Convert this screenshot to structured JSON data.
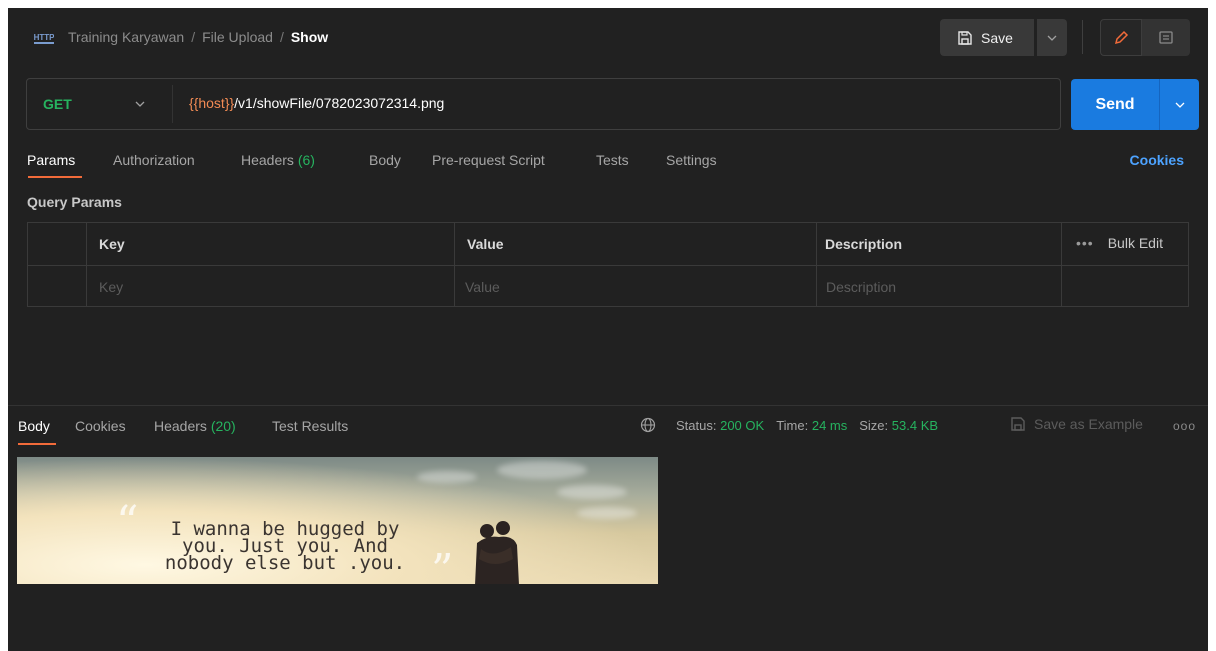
{
  "header": {
    "breadcrumb": [
      "Training Karyawan",
      "File Upload",
      "Show"
    ],
    "save_label": "Save"
  },
  "request": {
    "method": "GET",
    "url_var": "{{host}}",
    "url_path": "/v1/showFile/0782023072314.png",
    "send_label": "Send"
  },
  "tabs": {
    "params": "Params",
    "authorization": "Authorization",
    "headers": "Headers",
    "headers_count": "(6)",
    "body": "Body",
    "pre_request": "Pre-request Script",
    "tests": "Tests",
    "settings": "Settings",
    "cookies": "Cookies"
  },
  "query_params": {
    "title": "Query Params",
    "columns": [
      "Key",
      "Value",
      "Description"
    ],
    "bulk_edit": "Bulk Edit",
    "placeholders": [
      "Key",
      "Value",
      "Description"
    ]
  },
  "response": {
    "tabs": {
      "body": "Body",
      "cookies": "Cookies",
      "headers": "Headers",
      "headers_count": "(20)",
      "test_results": "Test Results"
    },
    "status_label": "Status:",
    "status_value": "200 OK",
    "time_label": "Time:",
    "time_value": "24 ms",
    "size_label": "Size:",
    "size_value": "53.4 KB",
    "save_as_example": "Save as Example",
    "image_text": [
      "I wanna be hugged by",
      "you. Just you. And",
      "nobody else but .you."
    ]
  },
  "colors": {
    "accent_orange": "#f26b3a",
    "get_green": "#26b35f",
    "send_blue": "#1a7be0",
    "link_blue": "#4da3ff"
  }
}
